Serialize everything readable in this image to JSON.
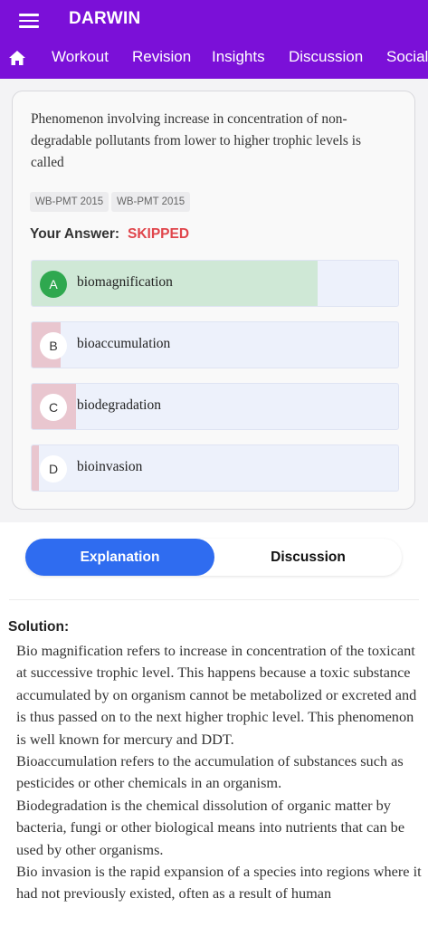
{
  "app": {
    "title": "DARWIN"
  },
  "tabs": [
    "Workout",
    "Revision",
    "Insights",
    "Discussion",
    "Social"
  ],
  "question": {
    "text": "Phenomenon involving increase in concentration of non-degradable pollutants from lower to higher trophic levels is called",
    "tags": [
      "WB-PMT 2015",
      "WB-PMT 2015"
    ],
    "your_answer_label": "Your Answer:",
    "your_answer_value": "SKIPPED"
  },
  "options": [
    {
      "letter": "A",
      "text": "biomagnification",
      "percent": 78,
      "correct": true
    },
    {
      "letter": "B",
      "text": "bioaccumulation",
      "percent": 8,
      "correct": false
    },
    {
      "letter": "C",
      "text": "biodegradation",
      "percent": 12,
      "correct": false
    },
    {
      "letter": "D",
      "text": "bioinvasion",
      "percent": 2,
      "correct": false
    }
  ],
  "colors": {
    "brand": "#7b10d8",
    "accent": "#2f6cf0",
    "correct_fill": "#cfe8d6",
    "correct_badge": "#2fa84f",
    "wrong_fill": "#e9c6cf",
    "skipped": "#e0454b"
  },
  "toggle": {
    "explanation": "Explanation",
    "discussion": "Discussion"
  },
  "solution": {
    "heading": "Solution:",
    "paragraphs": [
      "Bio magnification refers to increase in concentration of the toxicant at successive trophic level. This happens because a toxic substance accumulated by on organism cannot be metabolized or excreted and is thus passed on to the next higher trophic level. This phenomenon is well known for mercury and DDT.",
      "Bioaccumulation refers to the accumulation of substances such as pesticides or other chemicals in an organism.",
      "Biodegradation is the chemical dissolution of organic matter by bacteria, fungi or other biological means into nutrients that can be used by other organisms.",
      "Bio invasion is the rapid expansion of a species into regions where it had not previously existed, often as a result of human"
    ]
  }
}
